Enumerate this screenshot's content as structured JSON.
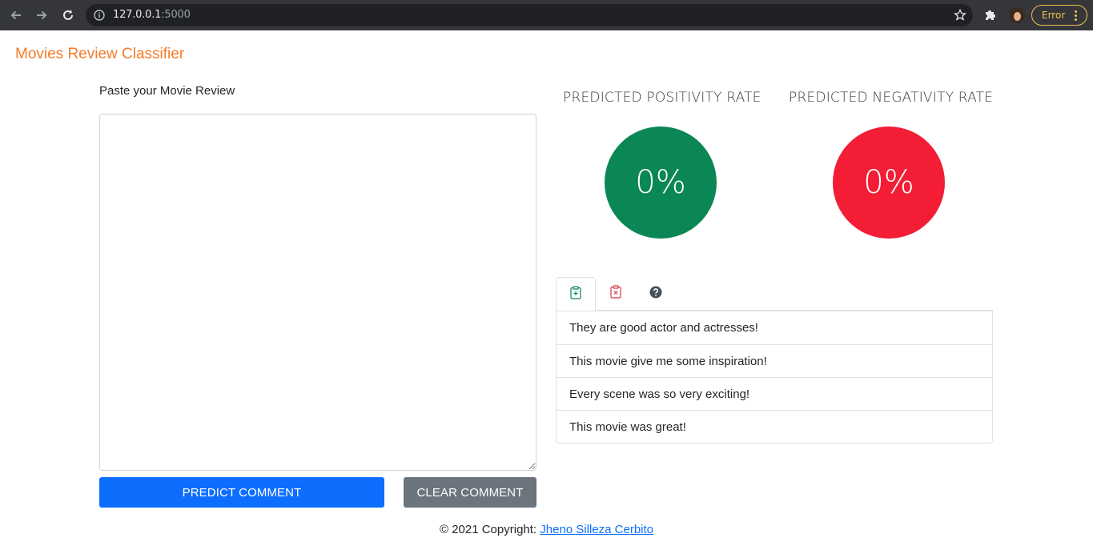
{
  "browser": {
    "url_host": "127.0.0.1",
    "url_port": ":5000",
    "status_label": "Error"
  },
  "brand": {
    "title": "Movies Review Classifier"
  },
  "review": {
    "label": "Paste your Movie Review",
    "value": "",
    "placeholder": ""
  },
  "actions": {
    "predict_label": "PREDICT COMMENT",
    "clear_label": "CLEAR COMMENT"
  },
  "rates": {
    "positive": {
      "title": "PREDICTED POSITIVITY RATE",
      "value": "0%",
      "color": "#0a8754"
    },
    "negative": {
      "title": "PREDICTED NEGATIVITY RATE",
      "value": "0%",
      "color": "#f31d36"
    }
  },
  "tabs": [
    {
      "icon": "clipboard-plus-icon",
      "color": "#0a8754",
      "active": true
    },
    {
      "icon": "clipboard-x-icon",
      "color": "#dc3545",
      "active": false
    },
    {
      "icon": "question-circle-icon",
      "color": "#495057",
      "active": false
    }
  ],
  "examples": [
    "They are good actor and actresses!",
    "This movie give me some inspiration!",
    "Every scene was so very exciting!",
    "This movie was great!"
  ],
  "footer": {
    "text": "© 2021 Copyright: ",
    "author": "Jheno Silleza Cerbito"
  }
}
